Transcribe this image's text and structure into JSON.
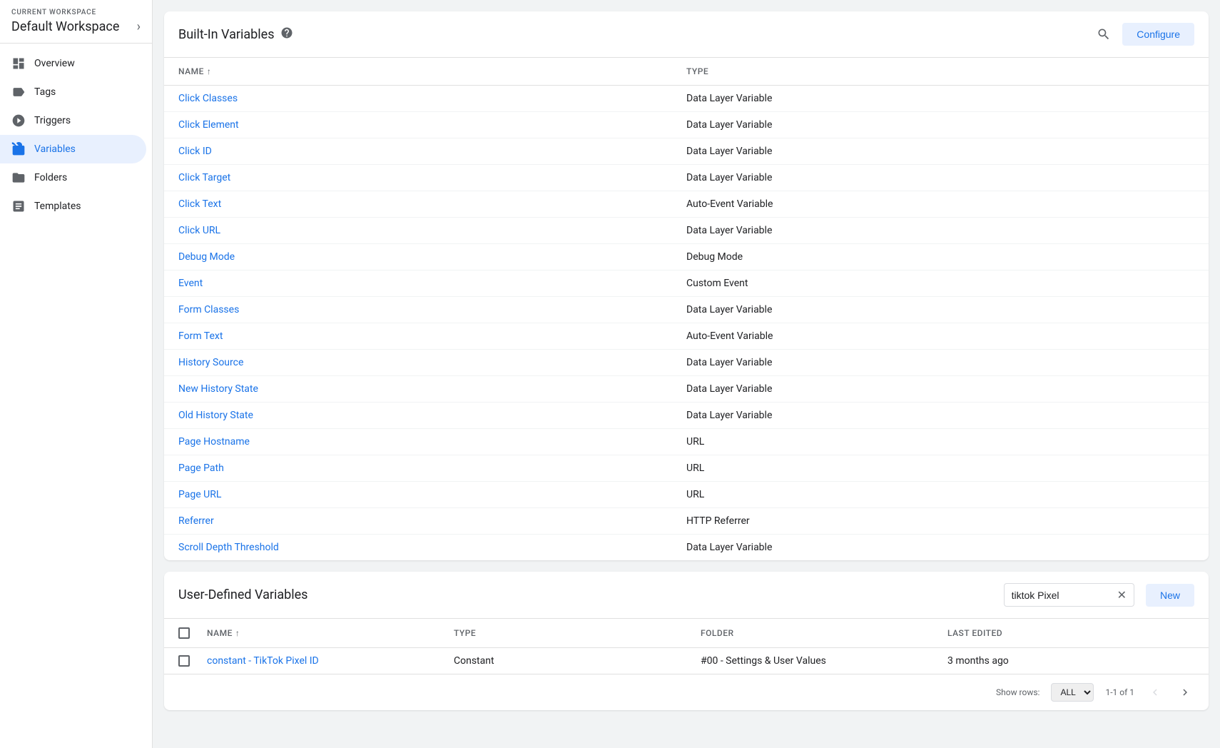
{
  "sidebar": {
    "workspace_label": "CURRENT WORKSPACE",
    "workspace_name": "Default Workspace",
    "items": [
      {
        "id": "overview",
        "label": "Overview",
        "active": false
      },
      {
        "id": "tags",
        "label": "Tags",
        "active": false
      },
      {
        "id": "triggers",
        "label": "Triggers",
        "active": false
      },
      {
        "id": "variables",
        "label": "Variables",
        "active": true
      },
      {
        "id": "folders",
        "label": "Folders",
        "active": false
      },
      {
        "id": "templates",
        "label": "Templates",
        "active": false
      }
    ]
  },
  "builtin_variables": {
    "title": "Built-In Variables",
    "columns": {
      "name": "Name",
      "type": "Type"
    },
    "rows": [
      {
        "name": "Click Classes",
        "type": "Data Layer Variable"
      },
      {
        "name": "Click Element",
        "type": "Data Layer Variable"
      },
      {
        "name": "Click ID",
        "type": "Data Layer Variable"
      },
      {
        "name": "Click Target",
        "type": "Data Layer Variable"
      },
      {
        "name": "Click Text",
        "type": "Auto-Event Variable"
      },
      {
        "name": "Click URL",
        "type": "Data Layer Variable"
      },
      {
        "name": "Debug Mode",
        "type": "Debug Mode"
      },
      {
        "name": "Event",
        "type": "Custom Event"
      },
      {
        "name": "Form Classes",
        "type": "Data Layer Variable"
      },
      {
        "name": "Form Text",
        "type": "Auto-Event Variable"
      },
      {
        "name": "History Source",
        "type": "Data Layer Variable"
      },
      {
        "name": "New History State",
        "type": "Data Layer Variable"
      },
      {
        "name": "Old History State",
        "type": "Data Layer Variable"
      },
      {
        "name": "Page Hostname",
        "type": "URL"
      },
      {
        "name": "Page Path",
        "type": "URL"
      },
      {
        "name": "Page URL",
        "type": "URL"
      },
      {
        "name": "Referrer",
        "type": "HTTP Referrer"
      },
      {
        "name": "Scroll Depth Threshold",
        "type": "Data Layer Variable"
      }
    ],
    "configure_label": "Configure"
  },
  "user_defined_variables": {
    "title": "User-Defined Variables",
    "search_value": "tiktok Pixel",
    "new_label": "New",
    "columns": {
      "name": "Name",
      "type": "Type",
      "folder": "Folder",
      "last_edited": "Last Edited"
    },
    "rows": [
      {
        "name": "constant - TikTok Pixel ID",
        "type": "Constant",
        "folder": "#00 - Settings & User Values",
        "last_edited": "3 months ago"
      }
    ],
    "pagination": {
      "show_rows_label": "Show rows:",
      "rows_option": "ALL",
      "page_info": "1-1 of 1"
    }
  }
}
